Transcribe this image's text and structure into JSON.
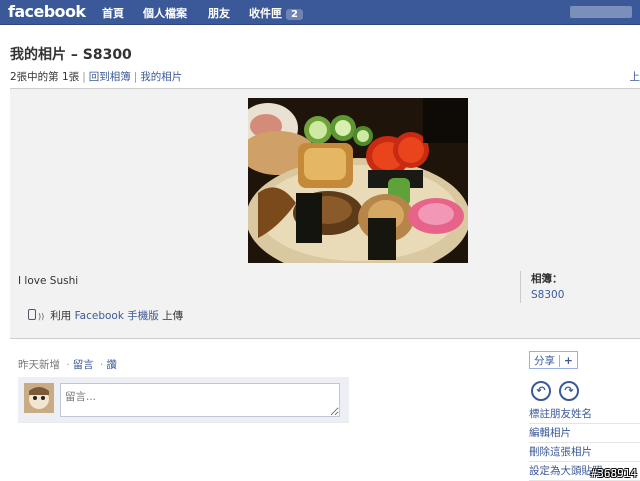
{
  "topbar": {
    "logo": "facebook",
    "nav": [
      "首頁",
      "個人檔案",
      "朋友",
      "收件匣"
    ],
    "inbox_count": "2"
  },
  "page": {
    "title": "我的相片 – S8300",
    "counter": "2張中的第 1張",
    "back_to_album": "回到相簿",
    "my_photos": "我的相片",
    "right_link": "上"
  },
  "photo": {
    "caption": "I love Sushi",
    "upload_prefix": "利用",
    "upload_app": "Facebook 手機版",
    "upload_suffix": "上傳",
    "album_label": "相簿：",
    "album_name": "S8300"
  },
  "comments": {
    "when": "昨天新增",
    "comment_link": "留言",
    "like_link": "讚",
    "placeholder": "留言..."
  },
  "sidebar": {
    "share": "分享",
    "plus": "+",
    "actions": [
      "標註朋友姓名",
      "編輯相片",
      "刪除這張相片",
      "設定為大頭貼照"
    ]
  },
  "watermark": "#368914",
  "colors": {
    "brand": "#3b5998",
    "link": "#3b5998",
    "photo_bg": "#f2f2f2"
  }
}
